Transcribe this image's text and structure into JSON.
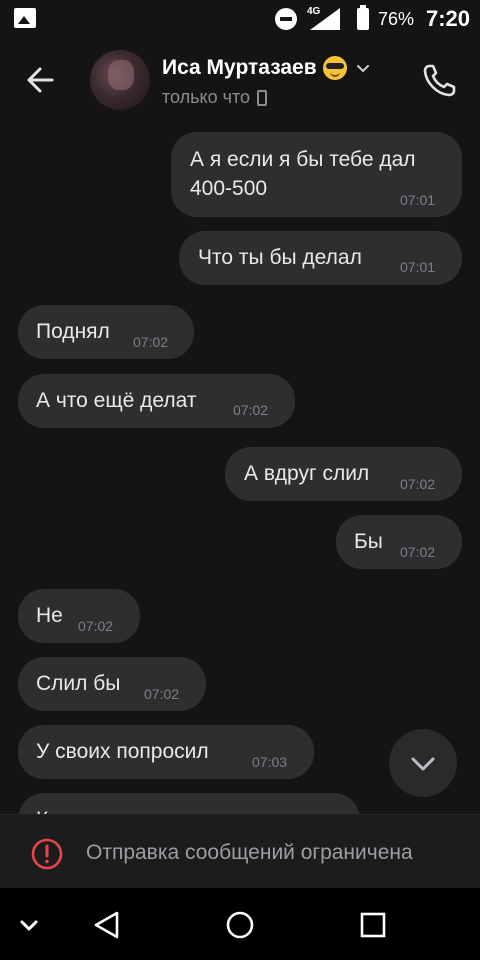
{
  "status_bar": {
    "network": "4G",
    "battery": "76%",
    "time": "7:20",
    "icons": [
      "image-icon",
      "do-not-disturb-icon",
      "signal-icon",
      "battery-icon"
    ]
  },
  "header": {
    "contact_name": "Иса Муртазаев",
    "contact_status": "только что",
    "icons": [
      "back-arrow-icon",
      "avatar",
      "sunglasses-emoji",
      "chevron-down-icon",
      "mobile-phone-icon",
      "call-icon"
    ]
  },
  "messages": [
    {
      "side": "out",
      "lines": [
        "А я если я бы тебе дал",
        "400-500"
      ],
      "time": "07:01"
    },
    {
      "side": "out",
      "lines": [
        "Что ты бы делал"
      ],
      "time": "07:01"
    },
    {
      "side": "in",
      "lines": [
        "Поднял"
      ],
      "time": "07:02"
    },
    {
      "side": "in",
      "lines": [
        "А что ещё делат"
      ],
      "time": "07:02"
    },
    {
      "side": "out",
      "lines": [
        "А вдруг слил"
      ],
      "time": "07:02"
    },
    {
      "side": "out",
      "lines": [
        "Бы"
      ],
      "time": "07:02"
    },
    {
      "side": "in",
      "lines": [
        "Не"
      ],
      "time": "07:02"
    },
    {
      "side": "in",
      "lines": [
        "Слил бы"
      ],
      "time": "07:02"
    },
    {
      "side": "in",
      "lines": [
        "У своих попросил"
      ],
      "time": "07:03"
    },
    {
      "side": "in",
      "lines": [
        "К"
      ],
      "time": ""
    }
  ],
  "restriction": {
    "text": "Отправка сообщений ограничена",
    "icon": "warning-circle-icon",
    "accent": "#e64646"
  },
  "navbar": {
    "icons": [
      "collapse-keyboard-icon",
      "back-triangle-icon",
      "home-circle-icon",
      "recents-square-icon"
    ]
  },
  "colors": {
    "background": "#141414",
    "bubble": "#2e2e30",
    "bubble_text": "#e8e9eb",
    "time_text": "#7d7f84"
  }
}
